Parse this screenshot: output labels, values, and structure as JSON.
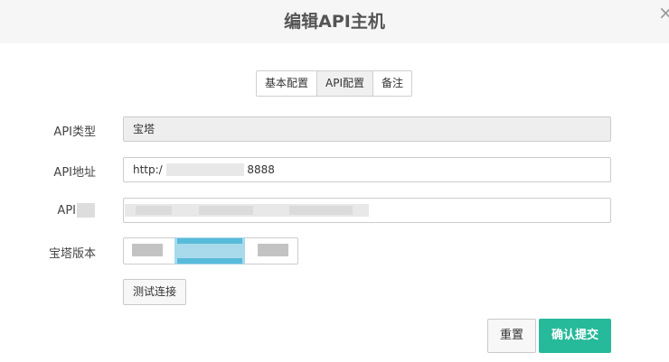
{
  "dialog": {
    "title": "编辑API主机",
    "close_icon": "×"
  },
  "tabs": [
    {
      "label": "基本配置"
    },
    {
      "label": "API配置"
    },
    {
      "label": "备注"
    }
  ],
  "form": {
    "api_type_label": "API类型",
    "api_type_value": "宝塔",
    "api_address_label": "API地址",
    "api_address_prefix": "http:/",
    "api_address_suffix": "8888",
    "api_key_label": "API",
    "panel_version_label": "宝塔版本"
  },
  "buttons": {
    "test_connection": "测试连接",
    "reset": "重置",
    "submit": "确认提交"
  },
  "colors": {
    "primary": "#26b99a",
    "header_bg": "#f6f6f6",
    "disabled_bg": "#eeeeee"
  }
}
